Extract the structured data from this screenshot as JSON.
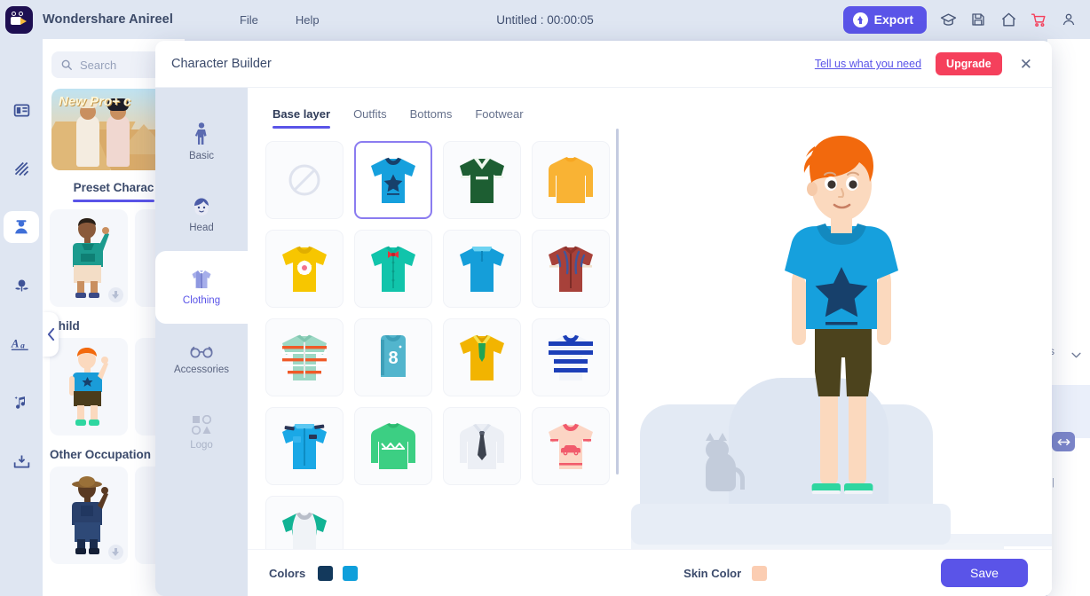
{
  "app": {
    "name": "Wondershare Anireel",
    "logo_icon": "anireel-logo-icon",
    "menu": [
      {
        "label": "File"
      },
      {
        "label": "Help"
      }
    ],
    "document_title": "Untitled : 00:00:05",
    "export_label": "Export",
    "titlebar_icons": [
      {
        "name": "academy-icon"
      },
      {
        "name": "save-icon"
      },
      {
        "name": "home-icon"
      },
      {
        "name": "cart-icon"
      },
      {
        "name": "account-icon"
      }
    ]
  },
  "rail": {
    "items": [
      {
        "name": "template-icon",
        "active": false
      },
      {
        "name": "background-icon",
        "active": false
      },
      {
        "name": "character-icon",
        "active": true
      },
      {
        "name": "prop-icon",
        "active": false
      },
      {
        "name": "text-icon",
        "active": false
      },
      {
        "name": "music-icon",
        "active": false
      },
      {
        "name": "import-icon",
        "active": false
      }
    ]
  },
  "library": {
    "search": {
      "placeholder": "Search",
      "value": ""
    },
    "promo": {
      "text": "New Pro+ c"
    },
    "tab": {
      "label": "Preset Charac"
    },
    "categories": [
      {
        "label": "Child"
      },
      {
        "label": "Other Occupation"
      }
    ]
  },
  "right_panel": {
    "dropdown_value": "s",
    "resize_icon": "resize-horizontal-icon"
  },
  "modal": {
    "title": "Character Builder",
    "tell_us_label": "Tell us what you need",
    "upgrade_label": "Upgrade",
    "close_label": "✕",
    "sidebar": [
      {
        "label": "Basic",
        "icon": "body-icon",
        "state": "normal"
      },
      {
        "label": "Head",
        "icon": "head-icon",
        "state": "normal"
      },
      {
        "label": "Clothing",
        "icon": "shirt-icon",
        "state": "active"
      },
      {
        "label": "Accessories",
        "icon": "glasses-icon",
        "state": "normal"
      },
      {
        "label": "Logo",
        "icon": "logo-shapes-icon",
        "state": "disabled"
      }
    ],
    "tabs": [
      {
        "label": "Base layer",
        "active": true
      },
      {
        "label": "Outfits",
        "active": false
      },
      {
        "label": "Bottoms",
        "active": false
      },
      {
        "label": "Footwear",
        "active": false
      }
    ],
    "items": [
      {
        "name": "none-option",
        "selected": false
      },
      {
        "name": "blue-star-tshirt",
        "selected": true
      },
      {
        "name": "green-v-neck-jersey",
        "selected": false
      },
      {
        "name": "orange-long-sleeve",
        "selected": false
      },
      {
        "name": "yellow-flower-tshirt",
        "selected": false
      },
      {
        "name": "teal-bowtie-shirt",
        "selected": false
      },
      {
        "name": "blue-polo-shirt",
        "selected": false
      },
      {
        "name": "red-hawaiian-shirt",
        "selected": false
      },
      {
        "name": "striped-green-shirt",
        "selected": false
      },
      {
        "name": "blue-number-8-jersey",
        "selected": false
      },
      {
        "name": "yellow-scarf-shirt",
        "selected": false
      },
      {
        "name": "blue-striped-tee",
        "selected": false
      },
      {
        "name": "blue-uniform-shirt",
        "selected": false
      },
      {
        "name": "green-zigzag-sweater",
        "selected": false
      },
      {
        "name": "white-shirt-with-tie",
        "selected": false
      },
      {
        "name": "pink-car-tshirt",
        "selected": false
      },
      {
        "name": "teal-white-shirt",
        "selected": false
      }
    ],
    "footer": {
      "colors_label": "Colors",
      "color_swatches": [
        "#13395c",
        "#0f9fdb"
      ],
      "skin_label": "Skin Color",
      "skin_swatch": "#fbcdb2",
      "save_label": "Save"
    }
  },
  "theme": {
    "accent": "#5a54e8",
    "upgrade": "#f5405c",
    "selected_border": "#8b7cf0",
    "titlebar_bg": "#dfe6f2"
  }
}
